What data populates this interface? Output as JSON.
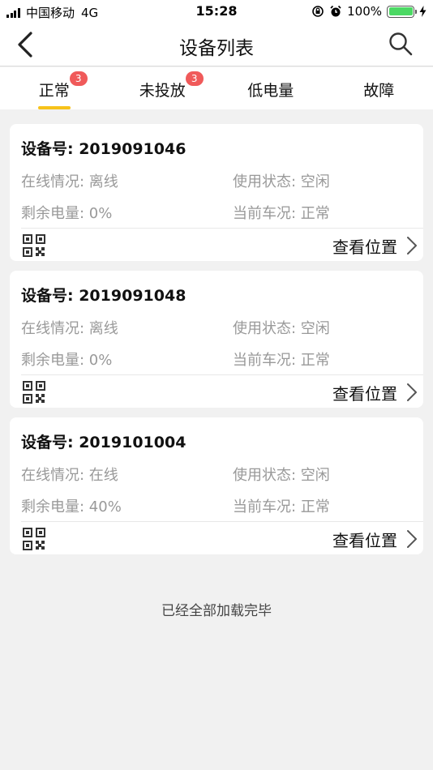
{
  "status_bar": {
    "carrier": "中国移动",
    "network": "4G",
    "time": "15:28",
    "battery_percent": "100%",
    "battery_color": "#4cd964"
  },
  "nav": {
    "title": "设备列表",
    "back_icon": "chevron-left-icon",
    "search_icon": "search-icon"
  },
  "tabs": [
    {
      "label": "正常",
      "badge": "3",
      "active": true
    },
    {
      "label": "未投放",
      "badge": "3",
      "active": false
    },
    {
      "label": "低电量",
      "badge": "",
      "active": false
    },
    {
      "label": "故障",
      "badge": "",
      "active": false
    }
  ],
  "accent_color": "#f7c21a",
  "badge_color": "#f05a5a",
  "devices": [
    {
      "title": "设备号: 2019091046",
      "online": "在线情况: 离线",
      "usage": "使用状态: 空闲",
      "battery": "剩余电量: 0%",
      "condition": "当前车况: 正常",
      "action": "查看位置"
    },
    {
      "title": "设备号: 2019091048",
      "online": "在线情况: 离线",
      "usage": "使用状态: 空闲",
      "battery": "剩余电量: 0%",
      "condition": "当前车况: 正常",
      "action": "查看位置"
    },
    {
      "title": "设备号: 2019101004",
      "online": "在线情况: 在线",
      "usage": "使用状态: 空闲",
      "battery": "剩余电量: 40%",
      "condition": "当前车况: 正常",
      "action": "查看位置"
    }
  ],
  "footer": "已经全部加载完毕"
}
